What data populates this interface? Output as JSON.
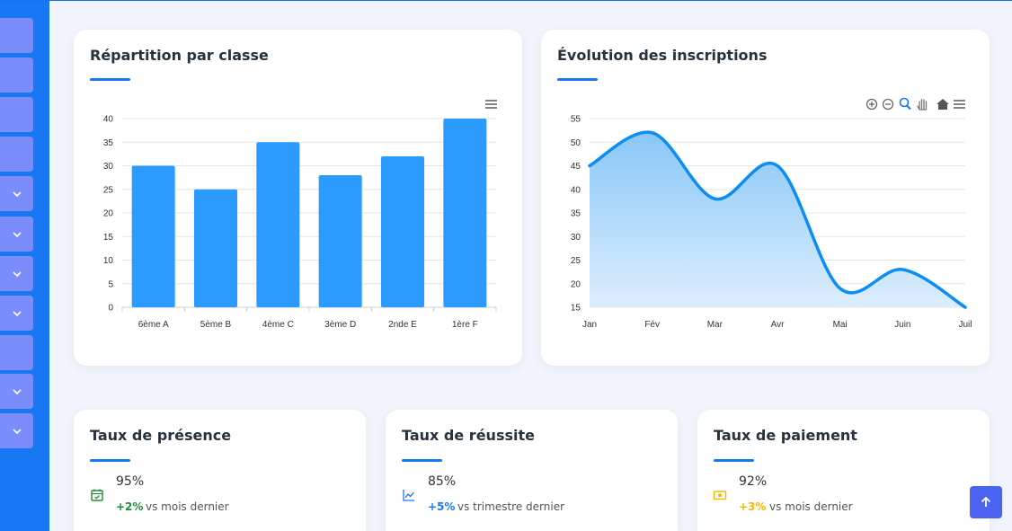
{
  "charts": {
    "bar": {
      "title": "Répartition par classe",
      "menu_icon": "hamburger-menu-icon"
    },
    "area": {
      "title": "Évolution des inscriptions",
      "toolbar_icons": [
        "zoom-in-icon",
        "zoom-out-icon",
        "zoom-selection-icon",
        "pan-icon",
        "home-icon",
        "hamburger-menu-icon"
      ]
    }
  },
  "chart_data": [
    {
      "type": "bar",
      "title": "Répartition par classe",
      "categories": [
        "6ème A",
        "5ème B",
        "4ème C",
        "3ème D",
        "2nde E",
        "1ère F"
      ],
      "values": [
        30,
        25,
        35,
        28,
        32,
        40
      ],
      "ylim": [
        0,
        40
      ],
      "yticks": [
        0,
        5,
        10,
        15,
        20,
        25,
        30,
        35,
        40
      ],
      "color": "#2b9bff",
      "grid": true
    },
    {
      "type": "area",
      "title": "Évolution des inscriptions",
      "categories": [
        "Jan",
        "Fév",
        "Mar",
        "Avr",
        "Mai",
        "Juin",
        "Juil"
      ],
      "values": [
        45,
        52,
        38,
        45,
        19,
        23,
        15
      ],
      "ylim": [
        15,
        55
      ],
      "yticks": [
        15,
        20,
        25,
        30,
        35,
        40,
        45,
        50,
        55
      ],
      "color": "#0b8df2",
      "grid": true
    }
  ],
  "stats": [
    {
      "title": "Taux de présence",
      "value": "95%",
      "change": "+2%",
      "desc": "vs mois dernier",
      "color": "#1e8e3e",
      "icon": "calendar-check-icon"
    },
    {
      "title": "Taux de réussite",
      "value": "85%",
      "change": "+5%",
      "desc": "vs trimestre dernier",
      "color": "#1877f2",
      "icon": "line-chart-icon"
    },
    {
      "title": "Taux de paiement",
      "value": "92%",
      "change": "+3%",
      "desc": "vs mois dernier",
      "color": "#f5b800",
      "icon": "money-icon"
    }
  ],
  "sidebar": {
    "items": [
      {
        "icon": ""
      },
      {
        "icon": ""
      },
      {
        "icon": ""
      },
      {
        "icon": ""
      },
      {
        "icon": "chevron-down-icon"
      },
      {
        "icon": "chevron-down-icon"
      },
      {
        "icon": "chevron-down-icon"
      },
      {
        "icon": "chevron-down-icon"
      },
      {
        "icon": ""
      },
      {
        "icon": "chevron-down-icon"
      },
      {
        "icon": "chevron-down-icon"
      }
    ]
  },
  "scroll_top_icon": "arrow-up-icon"
}
